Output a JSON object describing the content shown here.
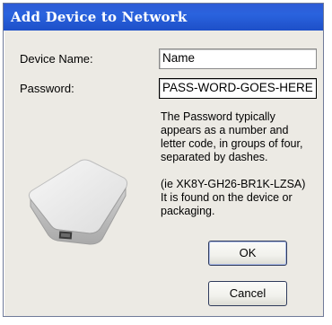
{
  "window": {
    "title": "Add Device to Network"
  },
  "form": {
    "device_name_label": "Device Name:",
    "device_name_value": "Name",
    "password_label": "Password:",
    "password_value": "PASS-WORD-GOES-HERE"
  },
  "help": {
    "line1": "The Password typically",
    "line2": "appears as a number and",
    "line3": "letter code, in groups of four,",
    "line4": "separated by dashes.",
    "line5": "(ie XK8Y-GH26-BR1K-LZSA)",
    "line6": "It is found on the device or",
    "line7": "packaging."
  },
  "buttons": {
    "ok_label": "OK",
    "cancel_label": "Cancel"
  },
  "colors": {
    "title_bar": "#2a63de",
    "dialog_bg": "#eceae4"
  },
  "icons": {
    "device": "powerline-adapter-icon"
  }
}
